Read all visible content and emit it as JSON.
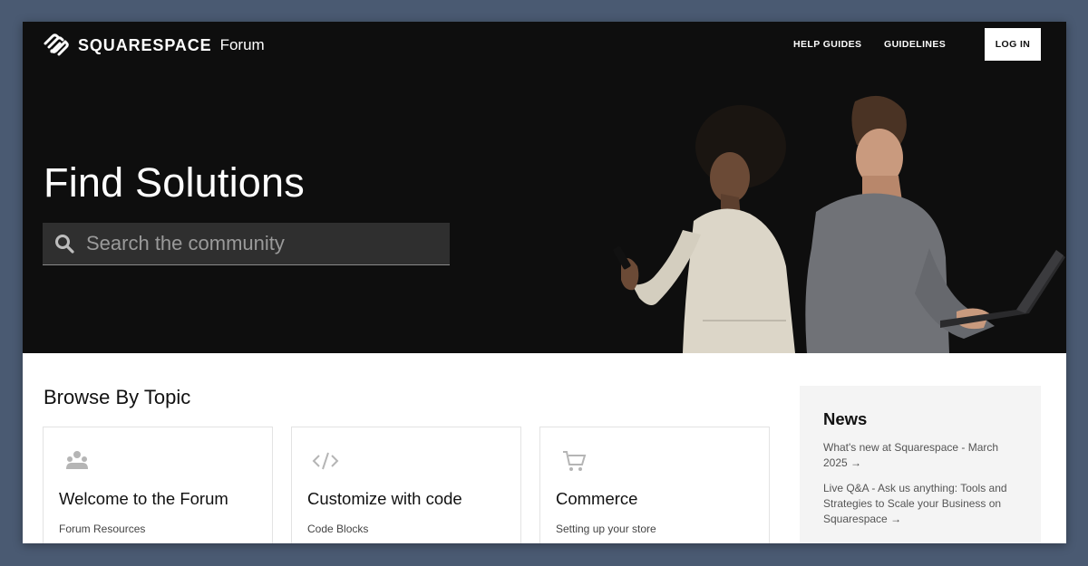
{
  "header": {
    "brand": "SQUARESPACE",
    "brand_suffix": "Forum",
    "nav": {
      "help_guides": "HELP GUIDES",
      "guidelines": "GUIDELINES",
      "login": "LOG IN"
    }
  },
  "hero": {
    "title": "Find Solutions",
    "search_placeholder": "Search the community"
  },
  "browse": {
    "title": "Browse By Topic",
    "cards": [
      {
        "icon": "community-icon",
        "title": "Welcome to the Forum",
        "link": "Forum Resources"
      },
      {
        "icon": "code-icon",
        "title": "Customize with code",
        "link": "Code Blocks"
      },
      {
        "icon": "cart-icon",
        "title": "Commerce",
        "link": "Setting up your store"
      }
    ]
  },
  "news": {
    "title": "News",
    "items": [
      {
        "text": "What's new at Squarespace - March 2025",
        "arrow": "→"
      },
      {
        "text": "Live Q&A - Ask us anything: Tools and Strategies to Scale your Business on Squarespace",
        "arrow": "→"
      }
    ]
  },
  "colors": {
    "page_background": "#4a5a72",
    "hero_background": "#0e0e0e",
    "search_background": "#2f2f2f",
    "news_background": "#f4f4f4",
    "icon_gray": "#b5b5b5"
  }
}
